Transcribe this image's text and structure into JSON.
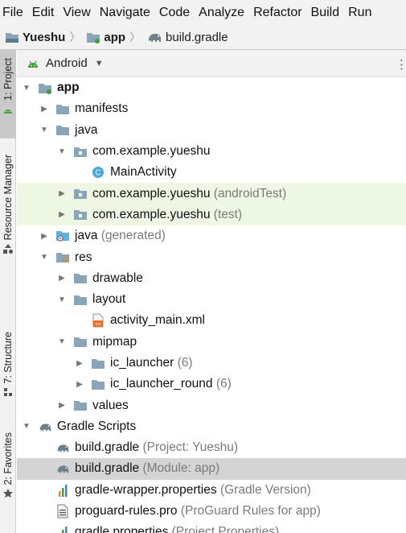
{
  "menu": [
    "File",
    "Edit",
    "View",
    "Navigate",
    "Code",
    "Analyze",
    "Refactor",
    "Build",
    "Run"
  ],
  "breadcrumb": [
    {
      "label": "Yueshu",
      "icon": "project-folder-icon",
      "bold": true
    },
    {
      "label": "app",
      "icon": "module-folder-icon",
      "bold": true
    },
    {
      "label": "build.gradle",
      "icon": "gradle-elephant-icon",
      "bold": false
    }
  ],
  "left_strip": {
    "project": "1: Project",
    "resource_manager": "Resource Manager",
    "structure": "7: Structure",
    "favorites": "2: Favorites"
  },
  "project_view": {
    "mode": "Android",
    "mode_icon": "android-icon"
  },
  "colors": {
    "test_row_bg": "#eef7e3",
    "selected_row_bg": "#d4d4d4",
    "folder": "#8aa4b8",
    "java_folder": "#62b0dd",
    "class_icon": "#4aa8d8",
    "gradle": "#6d7f8a"
  },
  "tree": [
    {
      "label": "app",
      "suffix": "",
      "level": 0,
      "arrow": "down",
      "icon": "module-folder-icon",
      "bold": true,
      "state": ""
    },
    {
      "label": "manifests",
      "suffix": "",
      "level": 1,
      "arrow": "right",
      "icon": "folder-icon",
      "bold": false,
      "state": ""
    },
    {
      "label": "java",
      "suffix": "",
      "level": 1,
      "arrow": "down",
      "icon": "folder-icon",
      "bold": false,
      "state": ""
    },
    {
      "label": "com.example.yueshu",
      "suffix": "",
      "level": 2,
      "arrow": "down",
      "icon": "package-icon",
      "bold": false,
      "state": ""
    },
    {
      "label": "MainActivity",
      "suffix": "",
      "level": 3,
      "arrow": "",
      "icon": "class-icon",
      "bold": false,
      "state": ""
    },
    {
      "label": "com.example.yueshu",
      "suffix": "(androidTest)",
      "level": 2,
      "arrow": "right",
      "icon": "package-icon",
      "bold": false,
      "state": "test"
    },
    {
      "label": "com.example.yueshu",
      "suffix": "(test)",
      "level": 2,
      "arrow": "right",
      "icon": "package-icon",
      "bold": false,
      "state": "test"
    },
    {
      "label": "java",
      "suffix": "(generated)",
      "level": 1,
      "arrow": "right",
      "icon": "generated-folder-icon",
      "bold": false,
      "state": ""
    },
    {
      "label": "res",
      "suffix": "",
      "level": 1,
      "arrow": "down",
      "icon": "res-folder-icon",
      "bold": false,
      "state": ""
    },
    {
      "label": "drawable",
      "suffix": "",
      "level": 2,
      "arrow": "right",
      "icon": "folder-icon",
      "bold": false,
      "state": ""
    },
    {
      "label": "layout",
      "suffix": "",
      "level": 2,
      "arrow": "down",
      "icon": "folder-icon",
      "bold": false,
      "state": ""
    },
    {
      "label": "activity_main.xml",
      "suffix": "",
      "level": 3,
      "arrow": "",
      "icon": "xml-file-icon",
      "bold": false,
      "state": ""
    },
    {
      "label": "mipmap",
      "suffix": "",
      "level": 2,
      "arrow": "down",
      "icon": "folder-icon",
      "bold": false,
      "state": ""
    },
    {
      "label": "ic_launcher",
      "suffix": "(6)",
      "level": 3,
      "arrow": "right",
      "icon": "folder-icon",
      "bold": false,
      "state": ""
    },
    {
      "label": "ic_launcher_round",
      "suffix": "(6)",
      "level": 3,
      "arrow": "right",
      "icon": "folder-icon",
      "bold": false,
      "state": ""
    },
    {
      "label": "values",
      "suffix": "",
      "level": 2,
      "arrow": "right",
      "icon": "folder-icon",
      "bold": false,
      "state": ""
    },
    {
      "label": "Gradle Scripts",
      "suffix": "",
      "level": 0,
      "arrow": "down",
      "icon": "gradle-elephant-icon",
      "bold": false,
      "state": ""
    },
    {
      "label": "build.gradle",
      "suffix": "(Project: Yueshu)",
      "level": 1,
      "arrow": "",
      "icon": "gradle-elephant-icon",
      "bold": false,
      "state": ""
    },
    {
      "label": "build.gradle",
      "suffix": "(Module: app)",
      "level": 1,
      "arrow": "",
      "icon": "gradle-elephant-icon",
      "bold": false,
      "state": "selected"
    },
    {
      "label": "gradle-wrapper.properties",
      "suffix": "(Gradle Version)",
      "level": 1,
      "arrow": "",
      "icon": "properties-file-icon",
      "bold": false,
      "state": ""
    },
    {
      "label": "proguard-rules.pro",
      "suffix": "(ProGuard Rules for app)",
      "level": 1,
      "arrow": "",
      "icon": "text-file-icon",
      "bold": false,
      "state": ""
    },
    {
      "label": "gradle.properties",
      "suffix": "(Project Properties)",
      "level": 1,
      "arrow": "",
      "icon": "properties-file-icon",
      "bold": false,
      "state": ""
    }
  ]
}
